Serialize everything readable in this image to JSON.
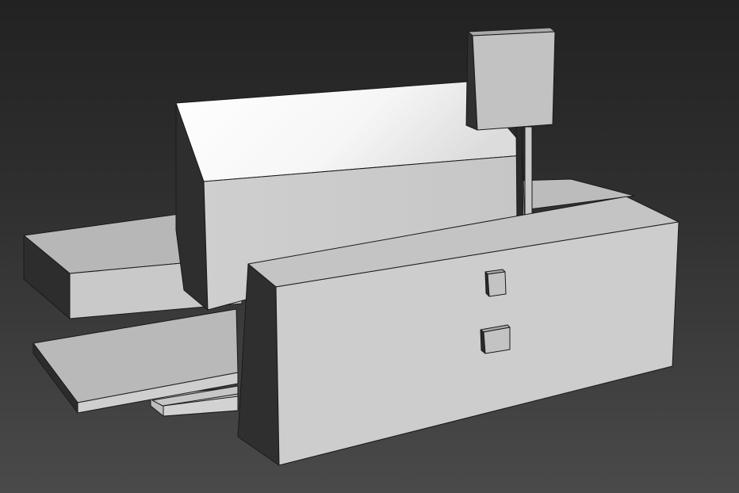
{
  "viewport": {
    "background_top": "#222222",
    "background_bottom": "#4a4a4a"
  },
  "model": {
    "face_light": "#d0d0d0",
    "face_mid": "#bdbdbd",
    "face_dark": "#2e2e2e",
    "face_highlight": "#ffffff",
    "edge": "#1a1a1a"
  }
}
